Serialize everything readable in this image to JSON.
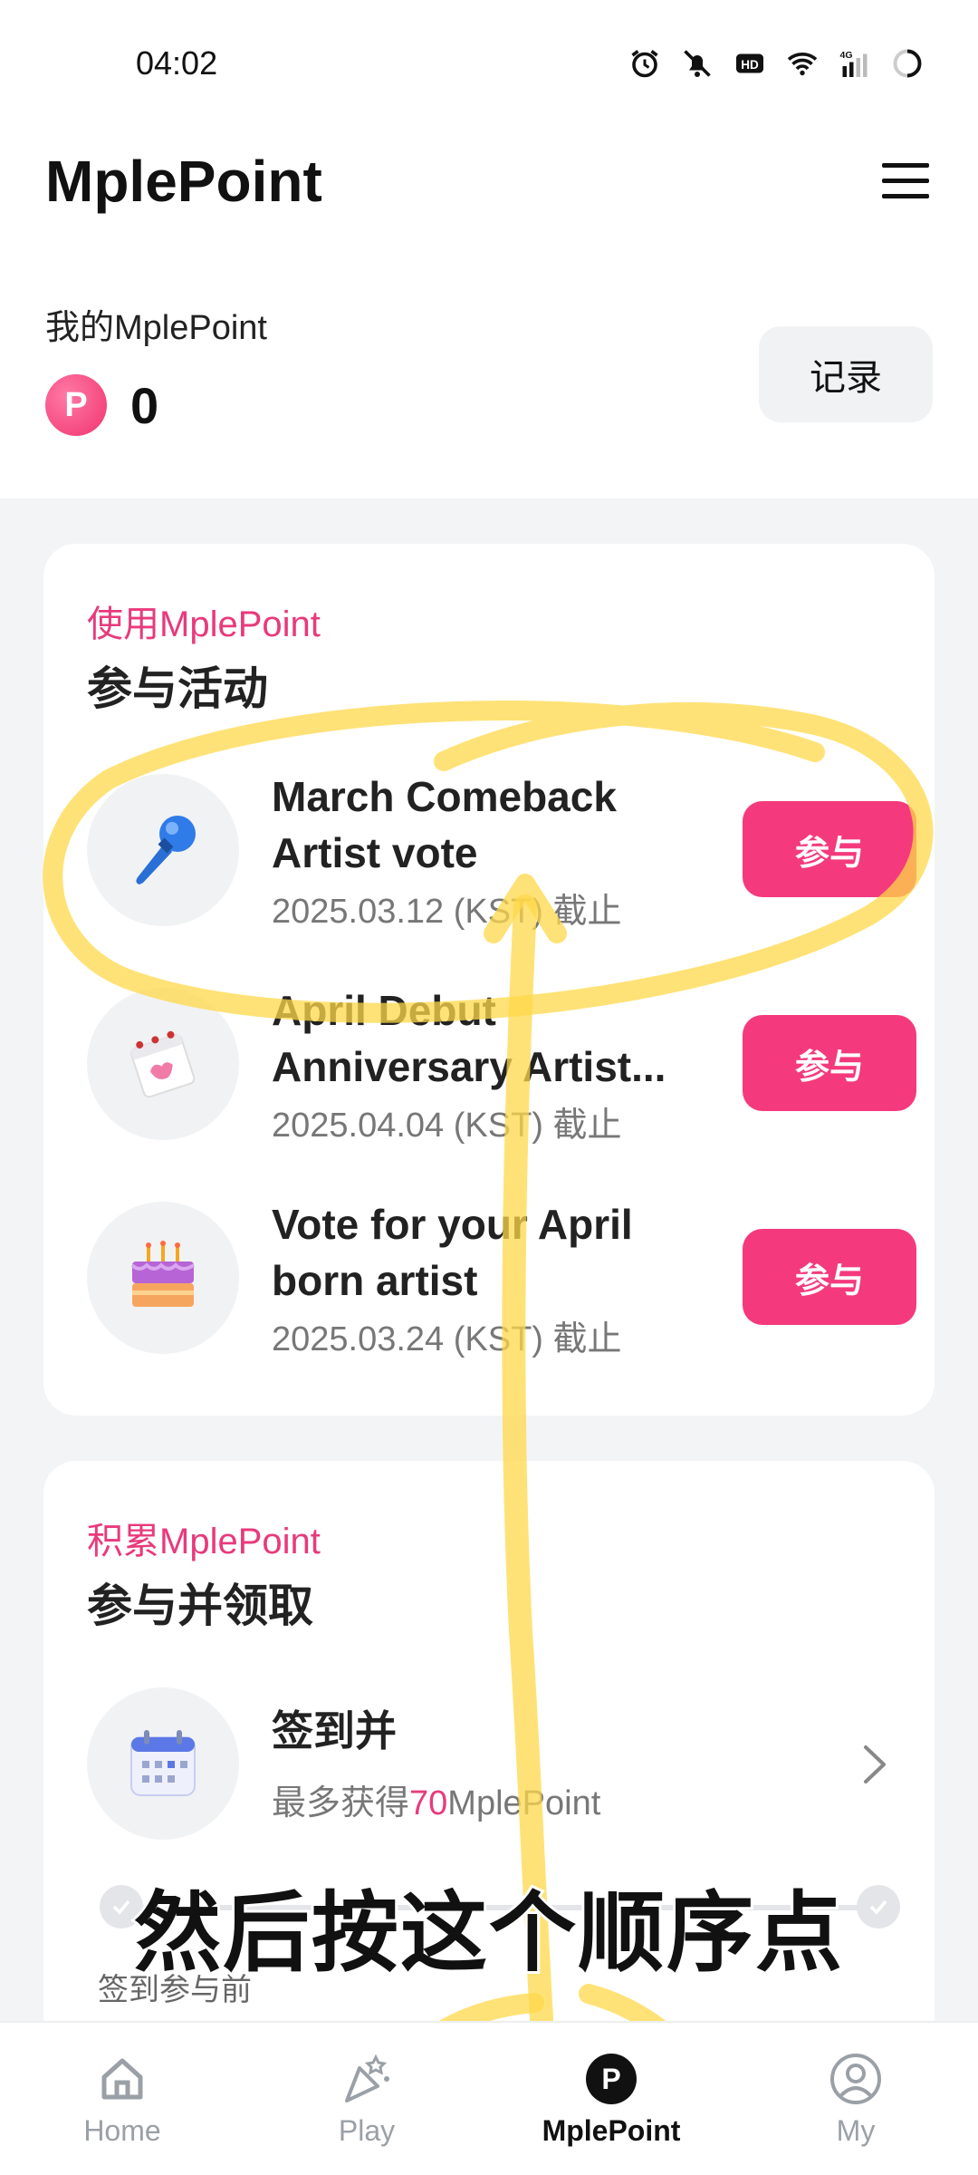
{
  "status_bar": {
    "time": "04:02",
    "icons": [
      "alarm-icon",
      "bell-off-icon",
      "hd-icon",
      "wifi-icon",
      "signal-4g-icon",
      "battery-charging-icon"
    ]
  },
  "app_bar": {
    "title": "MplePoint",
    "menu_icon": "hamburger-menu-icon"
  },
  "summary": {
    "label": "我的MplePoint",
    "points": "0",
    "badge_letter": "P",
    "record_button": "记录"
  },
  "use_card": {
    "kicker": "使用MplePoint",
    "title": "参与活动",
    "events": [
      {
        "name": "March Comeback Artist vote",
        "date": "2025.03.12 (KST) 截止",
        "button": "参与",
        "icon": "microphone-icon"
      },
      {
        "name": "April Debut Anniversary Artist...",
        "date": "2025.04.04 (KST) 截止",
        "button": "参与",
        "icon": "calendar-page-icon"
      },
      {
        "name": "Vote for your April born artist",
        "date": "2025.03.24 (KST) 截止",
        "button": "参与",
        "icon": "birthday-cake-icon"
      }
    ]
  },
  "earn_card": {
    "kicker": "积累MplePoint",
    "title": "参与并领取",
    "checkin": {
      "title": "签到并",
      "sub_prefix": "最多获得",
      "sub_highlight": "70",
      "sub_suffix": "MplePoint",
      "icon": "calendar-icon"
    },
    "note": "签到参与前"
  },
  "overlay": {
    "caption": "然后按这个顺序点"
  },
  "bottom_nav": [
    {
      "label": "Home",
      "icon": "home-icon",
      "active": false
    },
    {
      "label": "Play",
      "icon": "party-popper-icon",
      "active": false
    },
    {
      "label": "MplePoint",
      "icon": "points-p-icon",
      "active": true
    },
    {
      "label": "My",
      "icon": "user-circle-icon",
      "active": false
    }
  ],
  "colors": {
    "accent": "#f43a7c",
    "kicker": "#e83a7c",
    "background": "#f3f4f6",
    "scribble": "#ffd84a"
  }
}
